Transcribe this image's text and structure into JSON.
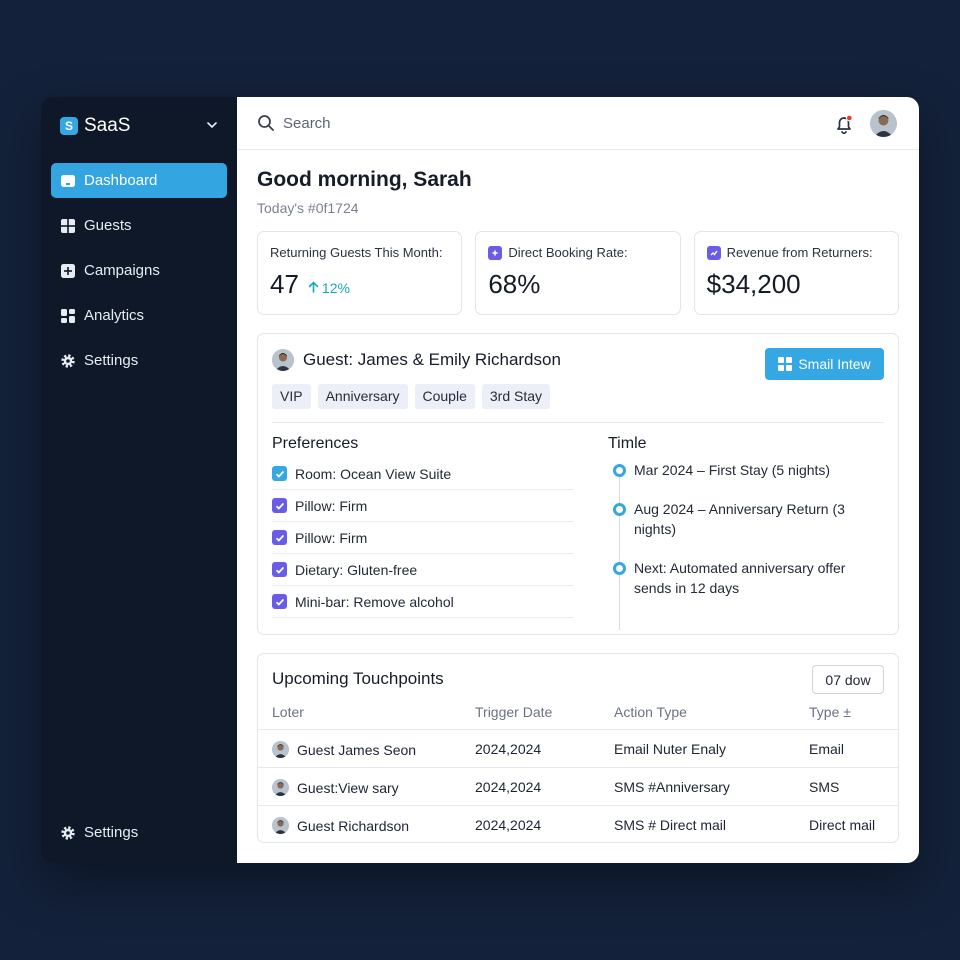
{
  "sidebar": {
    "brand": "SaaS",
    "items": [
      {
        "label": "Dashboard",
        "icon": "monitor-icon",
        "active": true
      },
      {
        "label": "Guests",
        "icon": "grid-icon"
      },
      {
        "label": "Campaigns",
        "icon": "plus-square-icon"
      },
      {
        "label": "Analytics",
        "icon": "dashboard-icon"
      },
      {
        "label": "Settings",
        "icon": "gear-icon"
      }
    ],
    "bottom": {
      "label": "Settings",
      "icon": "gear-icon"
    }
  },
  "topbar": {
    "search_placeholder": "Search"
  },
  "greeting": "Good morning, Sarah",
  "subgreeting": "Today's #0f1724",
  "stats": [
    {
      "label": "Returning Guests This Month:",
      "value": "47",
      "trend": "12%"
    },
    {
      "label": "Direct Booking Rate:",
      "value": "68%"
    },
    {
      "label": "Revenue from Returners:",
      "value": "$34,200"
    }
  ],
  "guest": {
    "name": "Guest: James & Emily Richardson",
    "button": "Smail Intew",
    "tags": [
      "VIP",
      "Anniversary",
      "Couple",
      "3rd Stay"
    ],
    "preferences_title": "Preferences",
    "preferences": [
      "Room: Ocean View Suite",
      "Pillow: Firm",
      "Pillow: Firm",
      "Dietary: Gluten-free",
      "Mini-bar: Remove alcohol"
    ],
    "timeline_title": "Timle",
    "timeline": [
      "Mar 2024 – First Stay (5 nights)",
      "Aug 2024 – Anniversary Return (3 nights)",
      "Next: Automated anniversary offer sends in 12 days"
    ]
  },
  "touchpoints": {
    "title": "Upcoming Touchpoints",
    "select": "07 dow",
    "columns": [
      "Loter",
      "Trigger Date",
      "Action Type",
      "Type ±"
    ],
    "rows": [
      [
        "Guest James Seon",
        "2024,2024",
        "Email Nuter Enaly",
        "Email"
      ],
      [
        "Guest:View sary",
        "2024,2024",
        "SMS #Anniversary",
        "SMS"
      ],
      [
        "Guest Richardson",
        "2024,2024",
        "SMS # Direct mail",
        "Direct mail"
      ]
    ]
  },
  "colors": {
    "accent": "#35a8e4",
    "purple": "#6b5ce7",
    "sidebar": "#0e1828",
    "background": "#13213a",
    "trend": "#1aa7b5",
    "alert": "#e53935"
  }
}
